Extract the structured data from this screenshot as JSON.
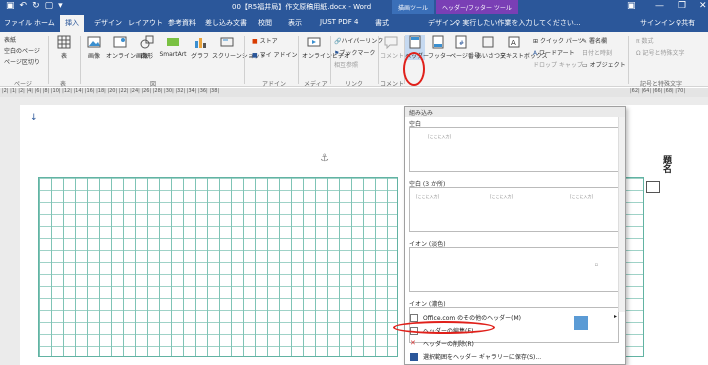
{
  "window": {
    "title": "00【R5福井局】作文原稿用紙.docx - Word",
    "ctx_header": "ヘッダー/フッター ツール",
    "ctx_draw": "描画ツール"
  },
  "tabs": {
    "file": "ファイル",
    "home": "ホーム",
    "insert": "挿入",
    "design": "デザイン",
    "layout": "レイアウト",
    "refs": "参考資料",
    "mail": "差し込み文書",
    "review": "校閲",
    "view": "表示",
    "justpdf": "JUST PDF 4",
    "format": "書式",
    "hfdesign": "デザイン",
    "tell": "♀ 実行したい作業を入力してください...",
    "signin": "サインイン",
    "share": "♀共有"
  },
  "ribbon": {
    "cover": "表紙",
    "blank": "空白のページ",
    "pagebreak": "ページ区切り",
    "grp_pages": "ページ",
    "table": "表",
    "grp_table": "表",
    "picture": "画像",
    "online_pic": "オンライン画像",
    "shapes": "図形",
    "smartart": "SmartArt",
    "chart": "グラフ",
    "screenshot": "スクリーンショット",
    "grp_figs": "図",
    "store": "ストア",
    "myaddin": "マイ アドイン",
    "grp_addin": "アドイン",
    "online_video": "オンラインビデオ",
    "grp_media": "メディア",
    "hyperlink": "ハイパーリンク",
    "bookmark": "ブックマーク",
    "xref": "相互参照",
    "grp_link": "リンク",
    "comment": "コメント",
    "grp_comment": "コメント",
    "header": "ヘッダー",
    "footer": "フッター",
    "pagenum": "ページ番号",
    "greeting": "あいさつ文",
    "textbox": "テキストボックス",
    "quickparts": "クイック パーツ",
    "wordart": "ワードアート",
    "dropcap": "ドロップ キャップ",
    "signature": "署名欄",
    "datetime": "日付と時刻",
    "object": "オブジェクト",
    "equation": "数式",
    "symbol": "記号と特殊文字",
    "grp_symbol": "記号と特殊文字"
  },
  "ruler": "|2| |1| |2| |4| |6| |8| |10| |12| |14| |16| |18| |20| |22| |24| |26| |28| |30| |32| |34| |36| |38|",
  "ruler_right": "|62| |64| |66| |68| |70|",
  "doc": {
    "title_side": "題名"
  },
  "gallery": {
    "section": "組み込み",
    "blank": "空白",
    "blank3": "空白 (3 か所)",
    "ion_light": "イオン (淡色)",
    "ion_dark": "イオン (濃色)",
    "placeholder": "[ここに入力]",
    "more_online": "Office.com のその他のヘッダー(M)",
    "edit_header": "ヘッダーの編集(E)",
    "remove_header": "ヘッダーの削除(R)",
    "save_selection": "選択範囲をヘッダー ギャラリーに保存(S)..."
  },
  "colors": {
    "accent": "#2b579a",
    "highlight": "#e0201a",
    "grid": "#7fc4b6",
    "ion_blue": "#5b9bd5"
  }
}
